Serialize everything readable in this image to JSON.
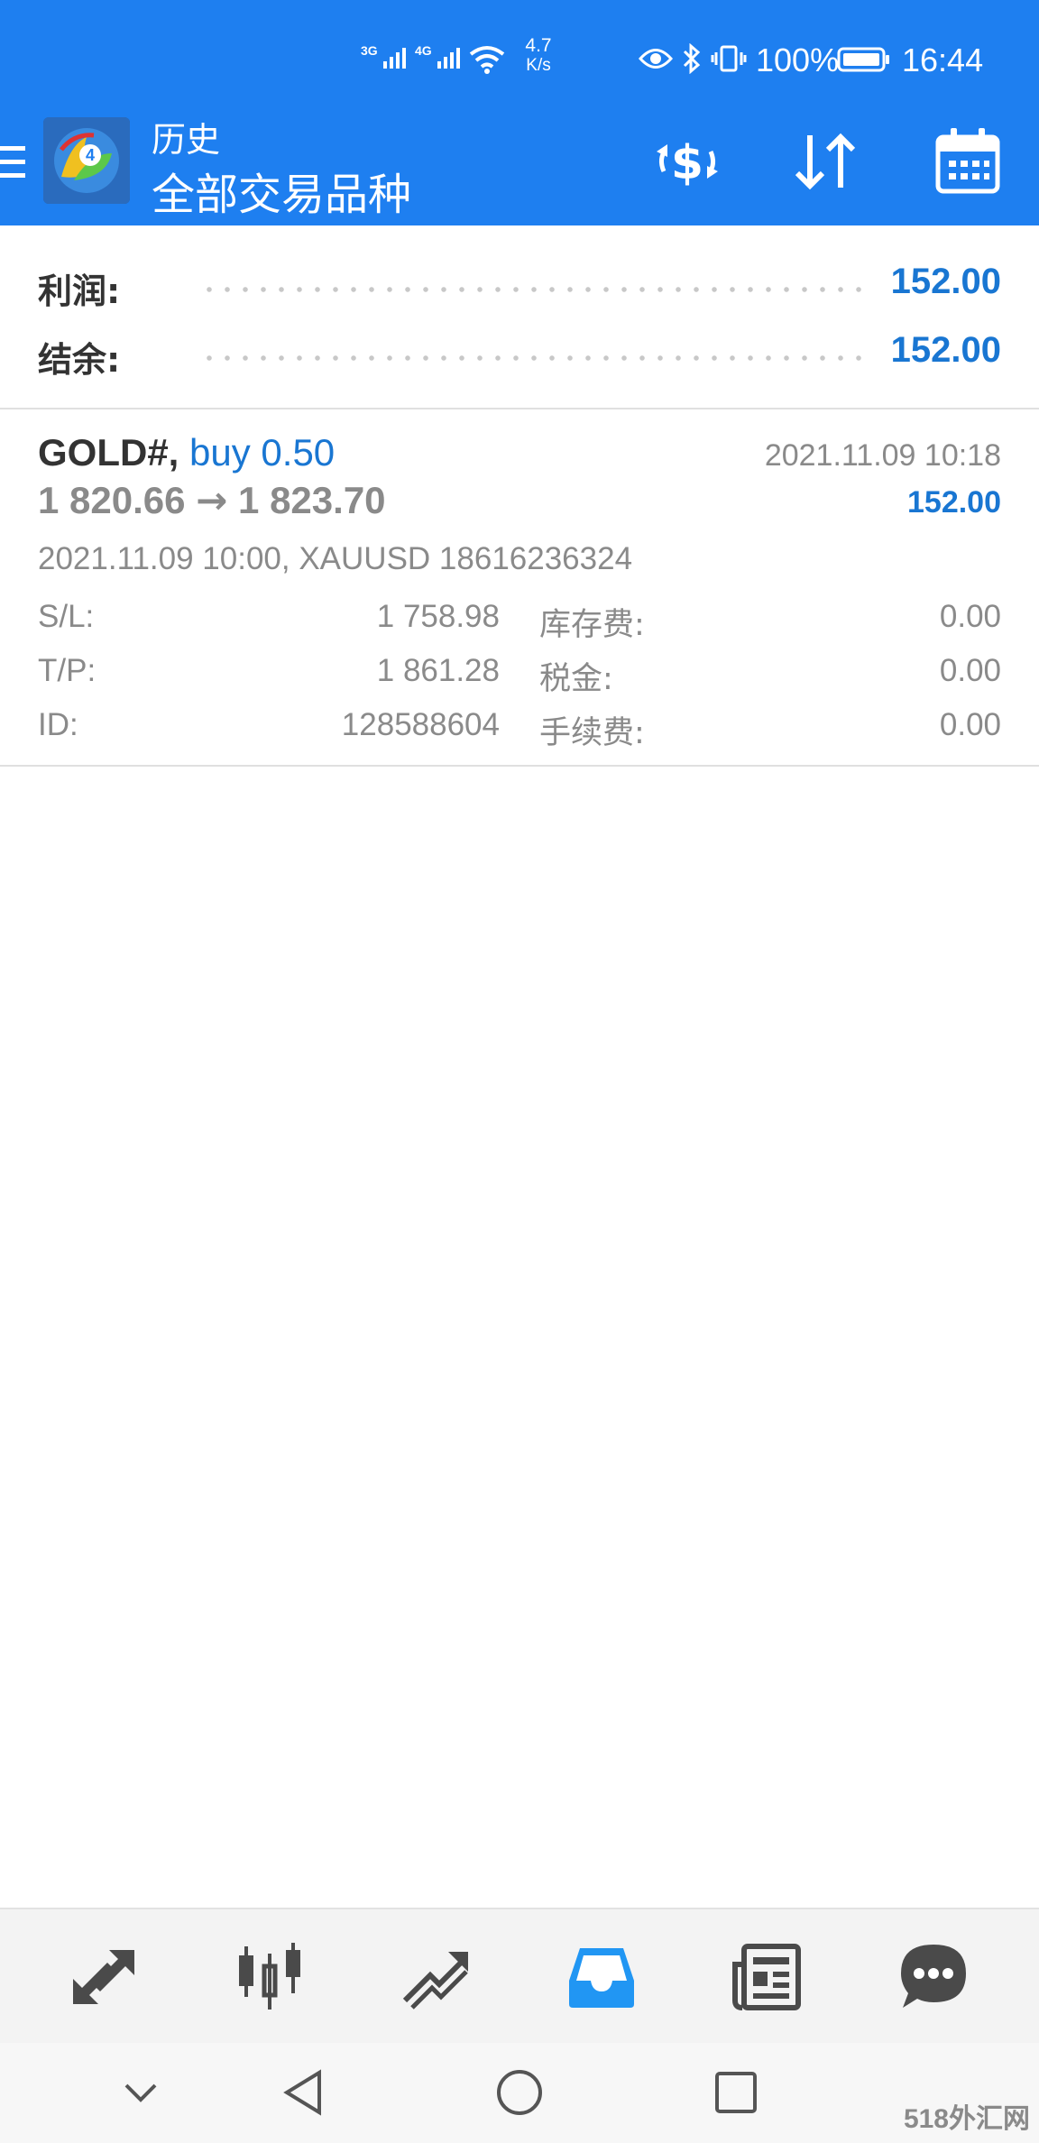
{
  "status_bar": {
    "signal1_label": "3G",
    "signal2_label": "4G",
    "speed_value": "4.7",
    "speed_unit": "K/s",
    "battery": "100%",
    "time": "16:44"
  },
  "app_bar": {
    "title": "历史",
    "subtitle": "全部交易品种",
    "accent_color": "#1e7ff0"
  },
  "summary": {
    "profit_label": "利润:",
    "profit_value": "152.00",
    "balance_label": "结余:",
    "balance_value": "152.00"
  },
  "trade": {
    "symbol": "GOLD#,",
    "side_volume": "buy 0.50",
    "price_open": "1 820.66",
    "arrow": "→",
    "price_close": "1 823.70",
    "close_time": "2021.11.09 10:18",
    "profit": "152.00",
    "open_info": "2021.11.09 10:00, XAUUSD 18616236324",
    "sl_label": "S/L:",
    "sl_value": "1 758.98",
    "tp_label": "T/P:",
    "tp_value": "1 861.28",
    "id_label": "ID:",
    "id_value": "128588604",
    "swap_label": "库存费:",
    "swap_value": "0.00",
    "tax_label": "税金:",
    "tax_value": "0.00",
    "commission_label": "手续费:",
    "commission_value": "0.00"
  },
  "bottom_nav": {
    "items": [
      "quotes-icon",
      "chart-icon",
      "trade-icon",
      "history-icon",
      "news-icon",
      "chat-icon"
    ],
    "active": "history-icon",
    "active_color": "#2196f3"
  },
  "watermark": "518外汇网"
}
